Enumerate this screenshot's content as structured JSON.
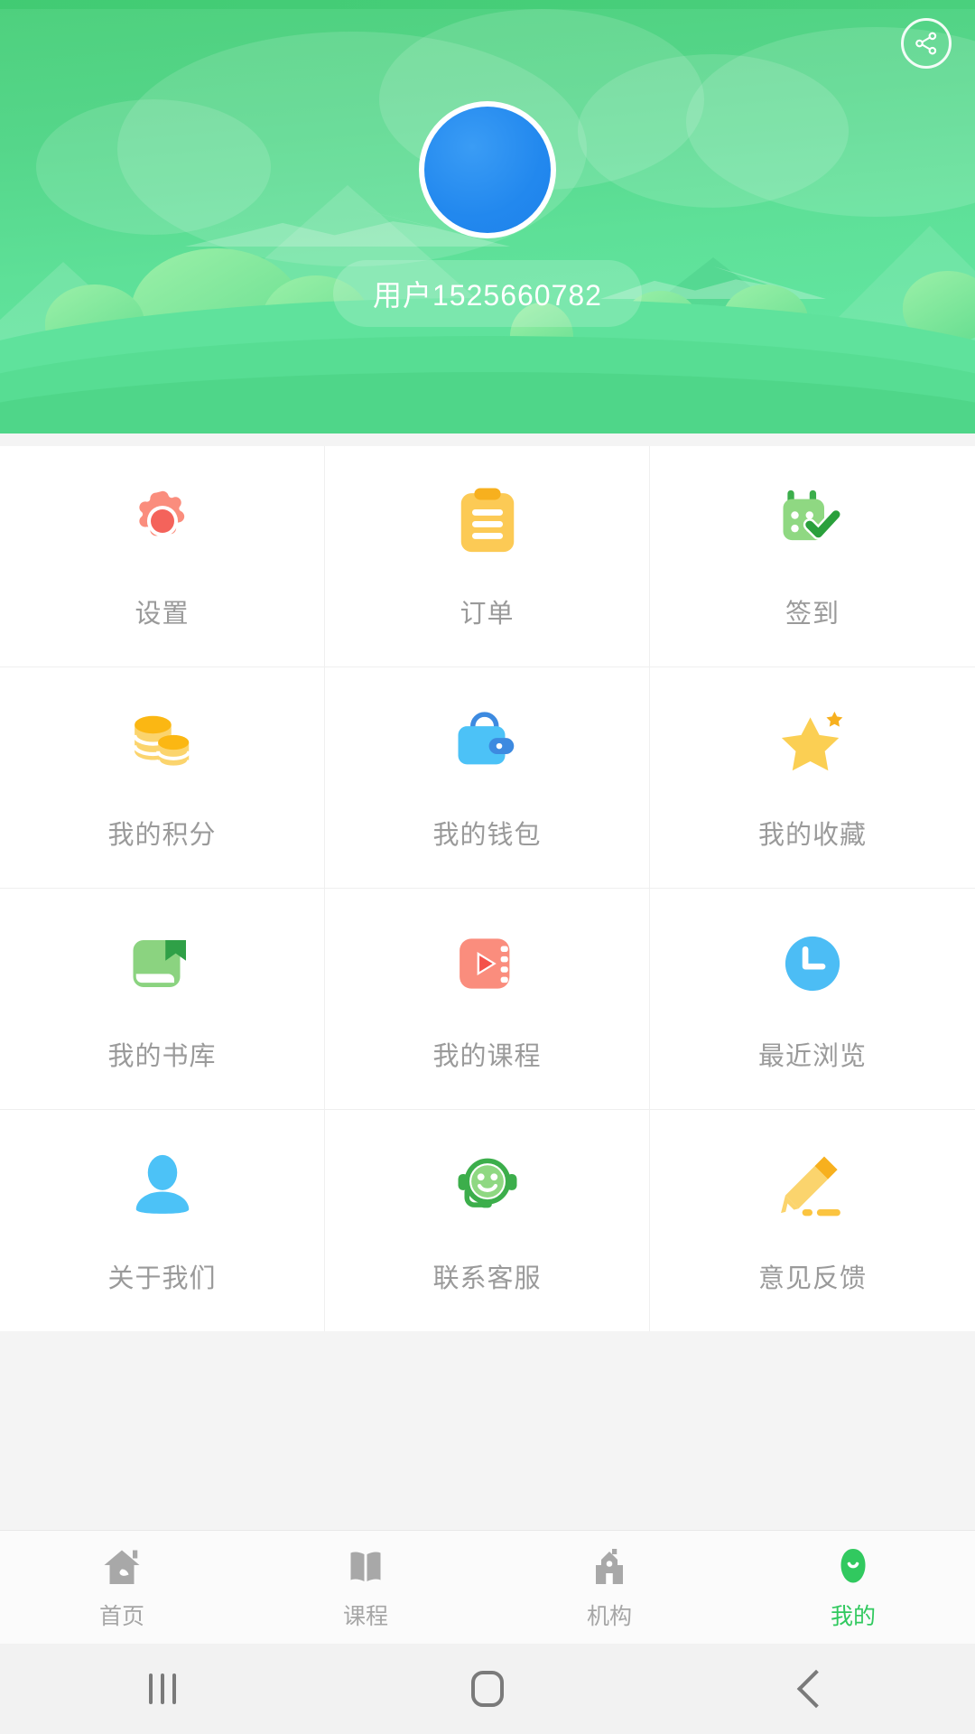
{
  "header": {
    "share_icon": "share-icon",
    "avatar_icon": "avatar",
    "username": "用户1525660782",
    "bg_gradient_from": "#4ed07d",
    "bg_gradient_to": "#63e7a3",
    "avatar_color": "#2288ee"
  },
  "grid": {
    "items": [
      {
        "label": "设置",
        "icon": "gear-icon",
        "color": "#fa8d7d"
      },
      {
        "label": "订单",
        "icon": "clipboard-icon",
        "color": "#fcca55"
      },
      {
        "label": "签到",
        "icon": "calendar-check-icon",
        "color": "#8fd882"
      },
      {
        "label": "我的积分",
        "icon": "coins-icon",
        "color": "#fbc440"
      },
      {
        "label": "我的钱包",
        "icon": "wallet-icon",
        "color": "#4cc2f7"
      },
      {
        "label": "我的收藏",
        "icon": "star-icon",
        "color": "#fbcf53"
      },
      {
        "label": "我的书库",
        "icon": "book-icon",
        "color": "#8bd380"
      },
      {
        "label": "我的课程",
        "icon": "video-icon",
        "color": "#fa8d7d"
      },
      {
        "label": "最近浏览",
        "icon": "clock-icon",
        "color": "#4cbdf5"
      },
      {
        "label": "关于我们",
        "icon": "person-icon",
        "color": "#4cc2f7"
      },
      {
        "label": "联系客服",
        "icon": "headset-smile-icon",
        "color": "#3cae4b"
      },
      {
        "label": "意见反馈",
        "icon": "pencil-icon",
        "color": "#fbc440"
      }
    ]
  },
  "tabbar": {
    "active_color": "#31c95f",
    "inactive_color": "#a6a6a6",
    "tabs": [
      {
        "label": "首页",
        "icon": "home-leaf-icon",
        "active": false
      },
      {
        "label": "课程",
        "icon": "open-book-icon",
        "active": false
      },
      {
        "label": "机构",
        "icon": "institution-icon",
        "active": false
      },
      {
        "label": "我的",
        "icon": "profile-tree-icon",
        "active": true
      }
    ]
  },
  "sysnav": {
    "buttons": [
      {
        "label": "recents",
        "icon": "recents-icon"
      },
      {
        "label": "home",
        "icon": "home-square-icon"
      },
      {
        "label": "back",
        "icon": "back-chevron-icon"
      }
    ]
  }
}
